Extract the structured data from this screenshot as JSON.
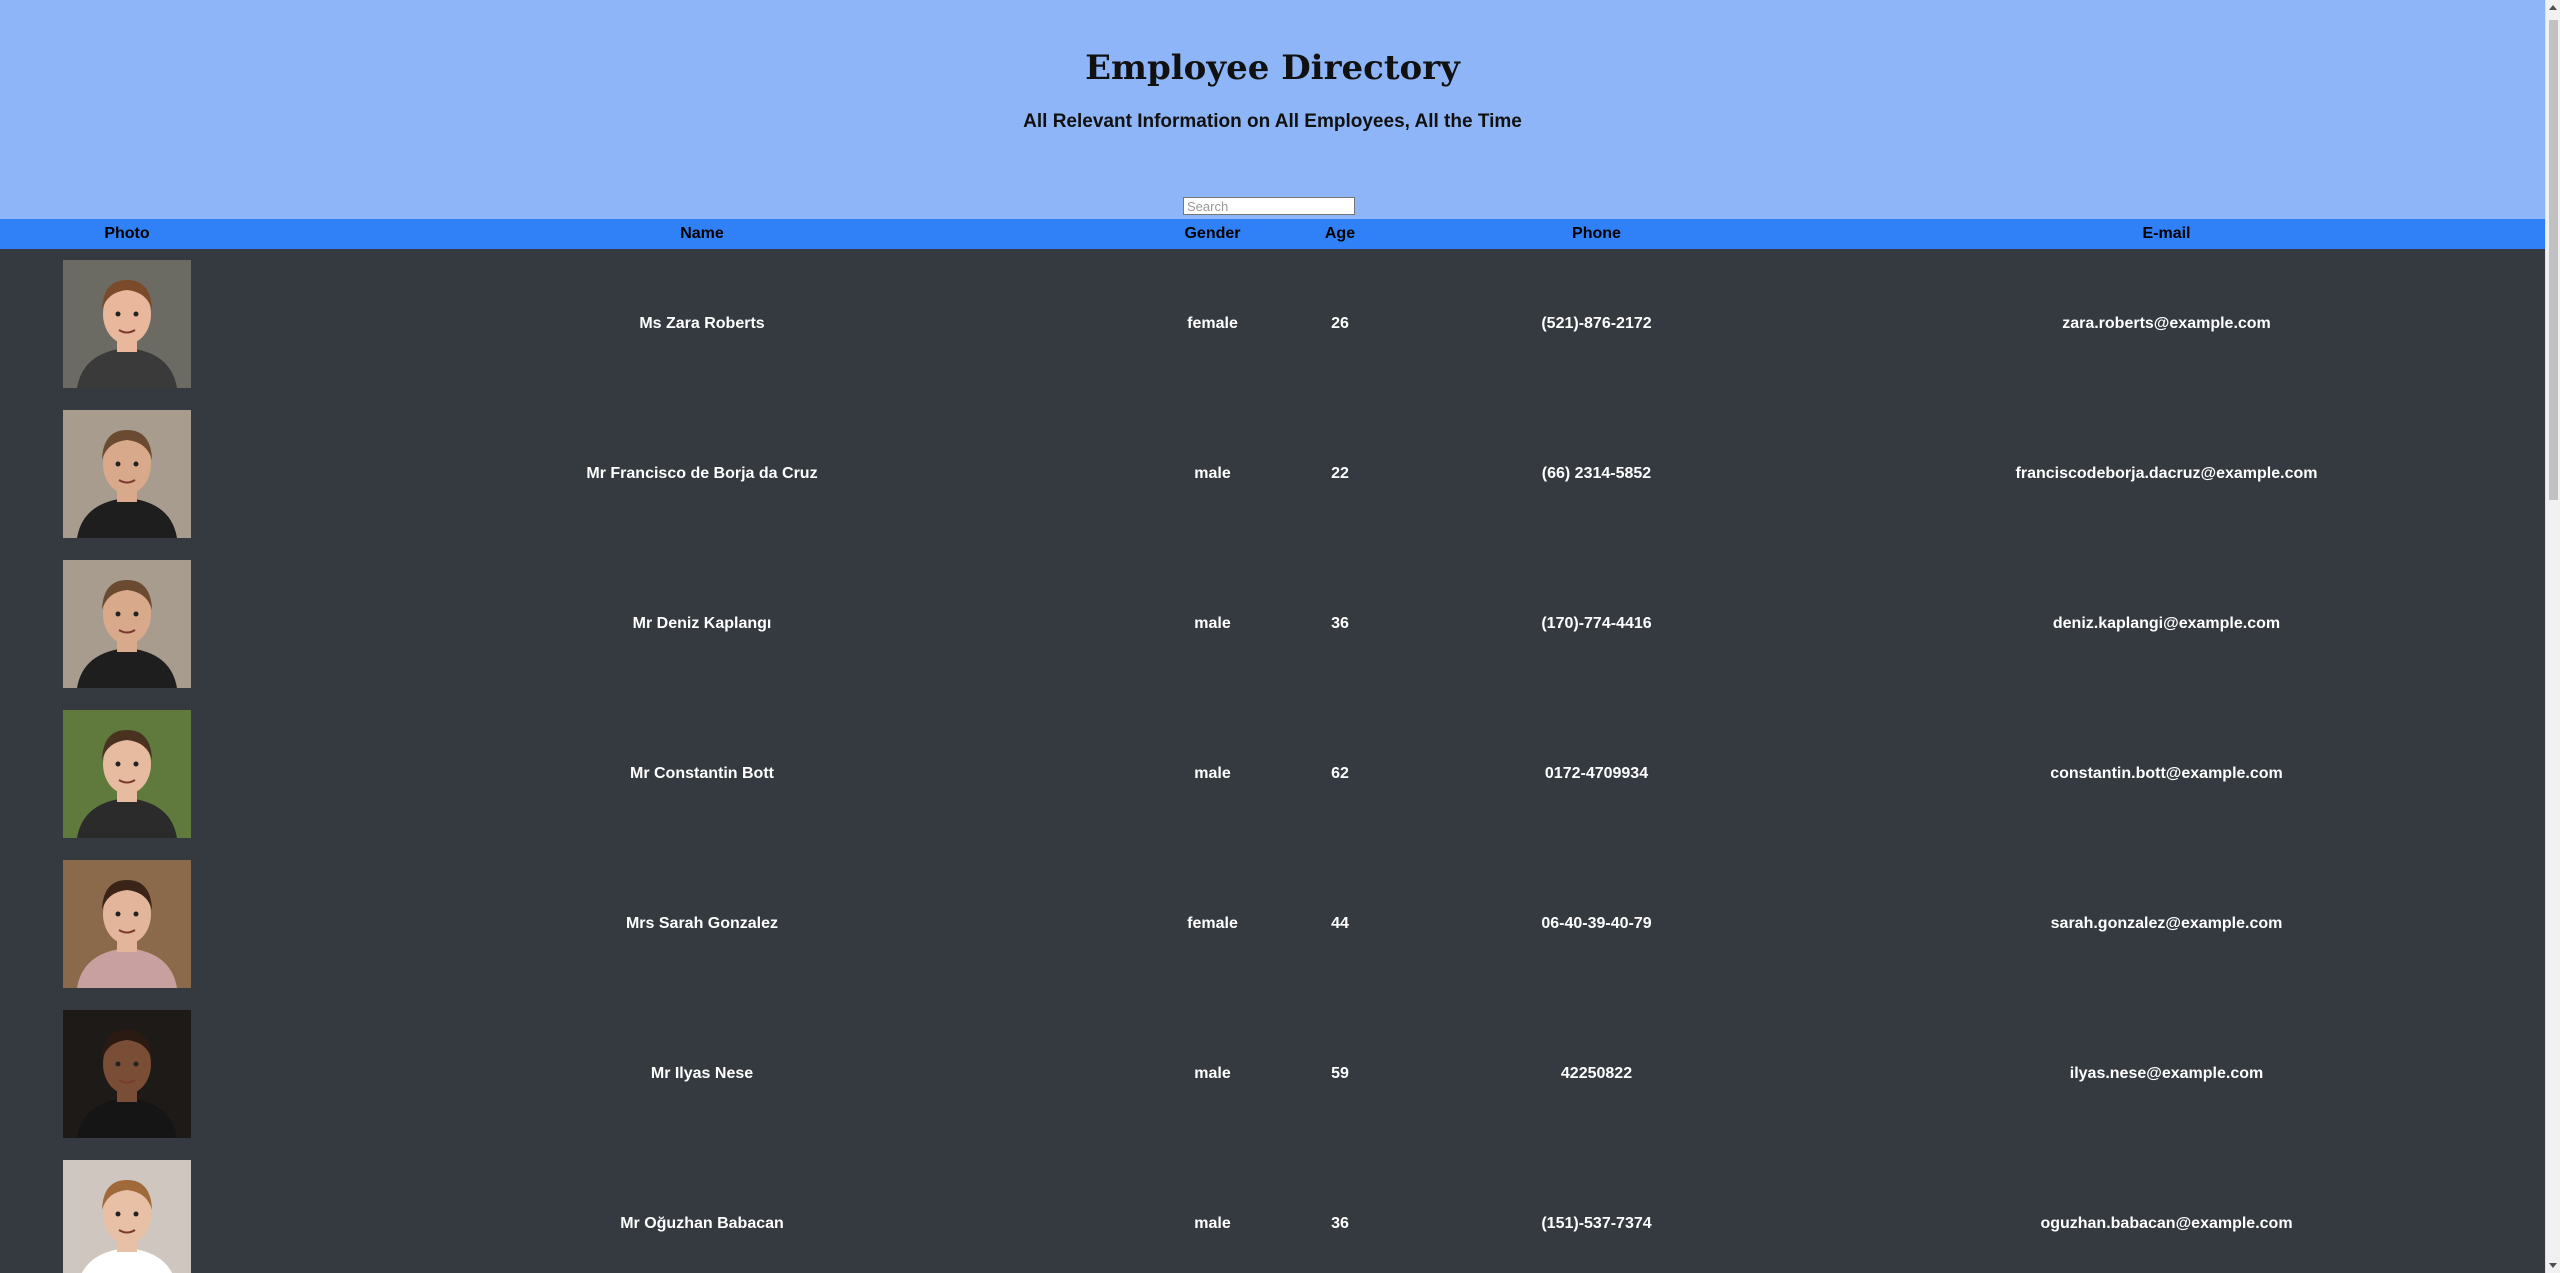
{
  "header": {
    "title": "Employee Directory",
    "subtitle": "All Relevant Information on All Employees, All the Time",
    "header_bg": "#8db5f7"
  },
  "search": {
    "placeholder": "Search",
    "value": ""
  },
  "table": {
    "header_bg": "#3081f7",
    "body_bg": "#343a40",
    "columns": [
      "Photo",
      "Name",
      "Gender",
      "Age",
      "Phone",
      "E-mail"
    ],
    "rows": [
      {
        "photo": "woman-portrait-photo",
        "name": "Ms Zara Roberts",
        "gender": "female",
        "age": "26",
        "phone": "(521)-876-2172",
        "email": "zara.roberts@example.com"
      },
      {
        "photo": "man-portrait-photo",
        "name": "Mr Francisco de Borja da Cruz",
        "gender": "male",
        "age": "22",
        "phone": "(66) 2314-5852",
        "email": "franciscodeborja.dacruz@example.com"
      },
      {
        "photo": "man-portrait-photo",
        "name": "Mr Deniz Kaplangı",
        "gender": "male",
        "age": "36",
        "phone": "(170)-774-4416",
        "email": "deniz.kaplangi@example.com"
      },
      {
        "photo": "man-portrait-photo",
        "name": "Mr Constantin Bott",
        "gender": "male",
        "age": "62",
        "phone": "0172-4709934",
        "email": "constantin.bott@example.com"
      },
      {
        "photo": "woman-portrait-photo",
        "name": "Mrs Sarah Gonzalez",
        "gender": "female",
        "age": "44",
        "phone": "06-40-39-40-79",
        "email": "sarah.gonzalez@example.com"
      },
      {
        "photo": "man-portrait-photo",
        "name": "Mr Ilyas Nese",
        "gender": "male",
        "age": "59",
        "phone": "42250822",
        "email": "ilyas.nese@example.com"
      },
      {
        "photo": "man-portrait-photo",
        "name": "Mr Oğuzhan Babacan",
        "gender": "male",
        "age": "36",
        "phone": "(151)-537-7374",
        "email": "oguzhan.babacan@example.com"
      }
    ]
  }
}
